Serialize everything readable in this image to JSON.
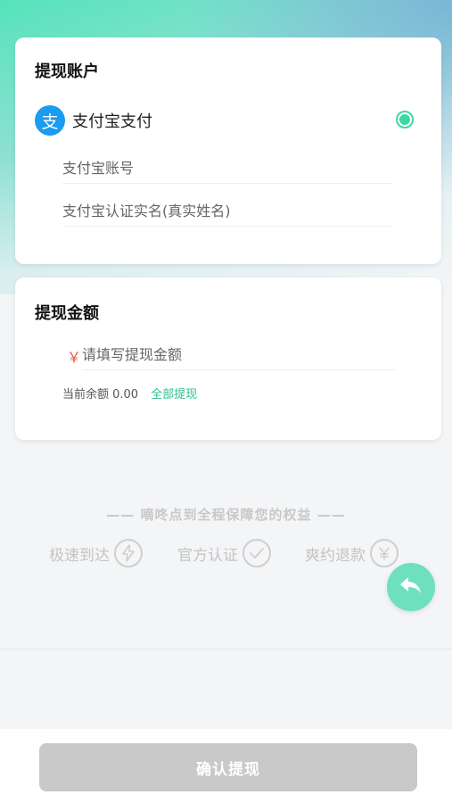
{
  "account_card": {
    "title": "提现账户",
    "alipay_label": "支付宝支付",
    "alipay_logo_char": "支",
    "account_placeholder": "支付宝账号",
    "name_placeholder": "支付宝认证实名(真实姓名)",
    "selected": true
  },
  "amount_card": {
    "title": "提现金额",
    "currency_symbol": "￥",
    "amount_placeholder": "请填写提现金额",
    "balance_label": "当前余额 0.00",
    "withdraw_all": "全部提现"
  },
  "guarantee": {
    "text": "—— 嘀咚点到全程保障您的权益 ——",
    "features": [
      {
        "label": "极速到达",
        "icon": "lightning-icon"
      },
      {
        "label": "官方认证",
        "icon": "check-circle-icon"
      },
      {
        "label": "爽约退款",
        "icon": "yen-refund-icon"
      }
    ]
  },
  "floating": {
    "icon": "back-arrow-icon"
  },
  "footer": {
    "confirm_label": "确认提现"
  },
  "colors": {
    "accent": "#3fd6a6",
    "alipay_blue": "#1a9cf0",
    "currency_red": "#e8593d",
    "disabled_button": "#c9c9c9"
  }
}
